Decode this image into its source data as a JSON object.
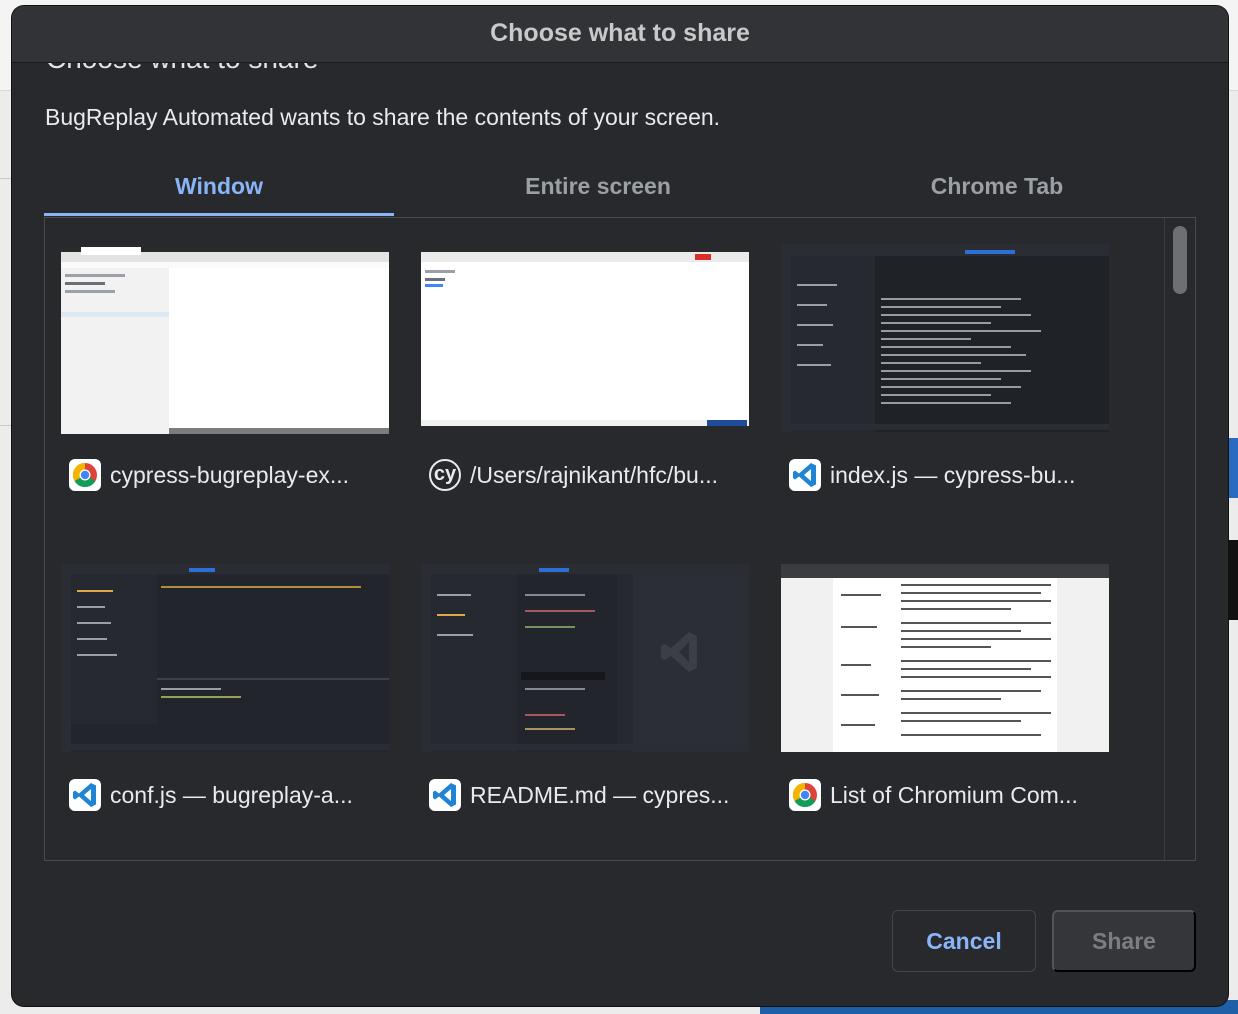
{
  "dialog": {
    "window_title": "Choose what to share",
    "heading": "Choose what to share",
    "description": "BugReplay Automated wants to share the contents of your screen."
  },
  "tabs": [
    {
      "label": "Window",
      "active": true
    },
    {
      "label": "Entire screen",
      "active": false
    },
    {
      "label": "Chrome Tab",
      "active": false
    }
  ],
  "windows": [
    {
      "name": "cypress-bugreplay-ex...",
      "icon": "chrome-icon",
      "preview": "light-browser"
    },
    {
      "name": "/Users/rajnikant/hfc/bu...",
      "icon": "cypress-icon",
      "icon_text": "cy",
      "preview": "light-blank"
    },
    {
      "name": "index.js — cypress-bu...",
      "icon": "vscode-icon",
      "preview": "dark-editor"
    },
    {
      "name": "conf.js — bugreplay-a...",
      "icon": "vscode-icon",
      "preview": "dark-editor-panel"
    },
    {
      "name": "README.md — cypres...",
      "icon": "vscode-icon",
      "preview": "dark-editor-logo"
    },
    {
      "name": "List of Chromium Com...",
      "icon": "chrome-icon",
      "preview": "light-document"
    }
  ],
  "buttons": {
    "cancel": "Cancel",
    "share": "Share"
  },
  "colors": {
    "accent": "#8ab4f8",
    "dialog_bg": "#28292c",
    "text": "#e8eaed",
    "muted": "#9aa0a6"
  }
}
